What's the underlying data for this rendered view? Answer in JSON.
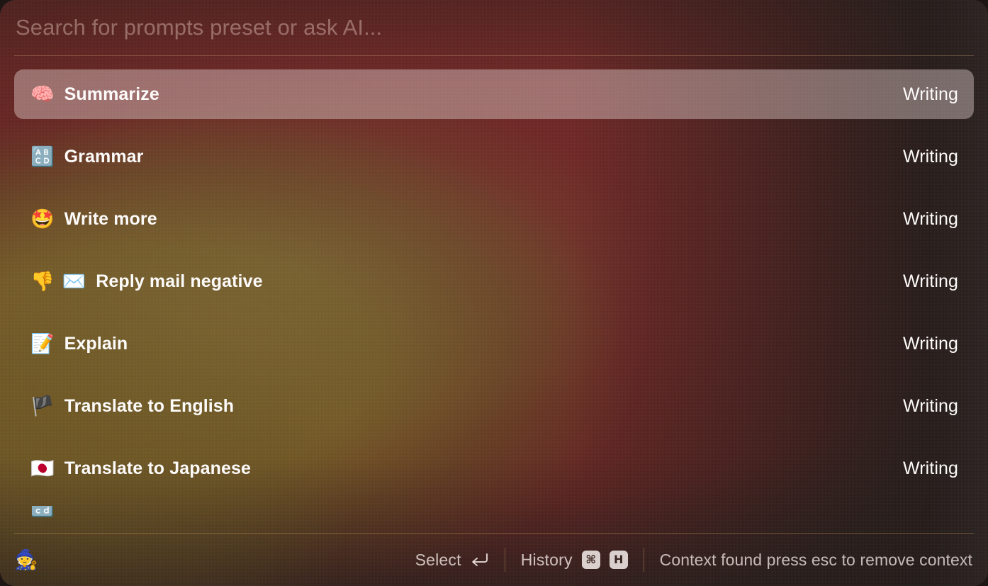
{
  "window": {
    "accent_red": "#6b2523",
    "accent_olive": "#7c6426",
    "selected_row_bg": "rgba(223,205,202,0.44)",
    "text_color": "#fdfbfa"
  },
  "search": {
    "placeholder": "Search for prompts preset or ask AI...",
    "value": ""
  },
  "results": [
    {
      "icons": [
        "🧠"
      ],
      "icon_names": [
        "brain-icon"
      ],
      "title": "Summarize",
      "category": "Writing",
      "selected": true
    },
    {
      "icons": [
        "🔠"
      ],
      "icon_names": [
        "input-latin-uppercase-icon"
      ],
      "title": "Grammar",
      "category": "Writing",
      "selected": false
    },
    {
      "icons": [
        "🤩"
      ],
      "icon_names": [
        "star-struck-icon"
      ],
      "title": "Write more",
      "category": "Writing",
      "selected": false
    },
    {
      "icons": [
        "👎",
        "✉️"
      ],
      "icon_names": [
        "thumbs-down-icon",
        "envelope-icon"
      ],
      "title": "Reply mail negative",
      "category": "Writing",
      "selected": false
    },
    {
      "icons": [
        "📝"
      ],
      "icon_names": [
        "memo-icon"
      ],
      "title": "Explain",
      "category": "Writing",
      "selected": false
    },
    {
      "icons": [
        "🏴"
      ],
      "icon_names": [
        "flag-england-icon"
      ],
      "title": "Translate to English",
      "category": "Writing",
      "selected": false
    },
    {
      "icons": [
        "🇯🇵"
      ],
      "icon_names": [
        "flag-japan-icon"
      ],
      "title": "Translate to Japanese",
      "category": "Writing",
      "selected": false
    },
    {
      "icons": [
        "🔡"
      ],
      "icon_names": [
        "partial-row-icon"
      ],
      "title": "",
      "category": "",
      "selected": false,
      "partial": true
    }
  ],
  "footer": {
    "brand_icon": "🧙",
    "select_label": "Select",
    "select_key": "↵",
    "history_label": "History",
    "history_keys": [
      "⌘",
      "H"
    ],
    "context_message": "Context found press esc to remove context"
  }
}
